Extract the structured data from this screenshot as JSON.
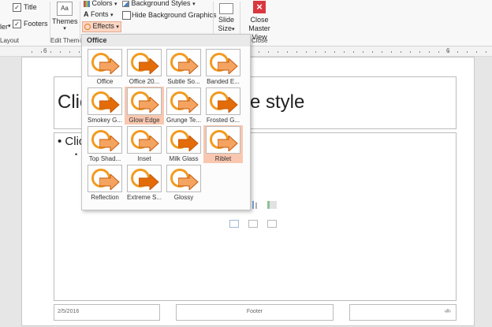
{
  "ribbon": {
    "layout_group": {
      "partial_label": "ler",
      "group_label": "Layout",
      "title_checkbox": {
        "label": "Title",
        "checked": true
      },
      "footers_checkbox": {
        "label": "Footers",
        "checked": true
      }
    },
    "edit_theme_group": {
      "themes_label": "Themes",
      "group_label": "Edit Theme"
    },
    "background_group": {
      "colors_label": "Colors",
      "fonts_label": "Fonts",
      "effects_label": "Effects",
      "background_styles_label": "Background Styles",
      "hide_background_label": "Hide Background Graphics"
    },
    "size_group": {
      "slide_size_label_1": "Slide",
      "slide_size_label_2": "Size"
    },
    "close_group": {
      "close_label_1": "Close",
      "close_label_2": "Master View",
      "group_label": "Close"
    }
  },
  "ruler": {
    "left_number": "6",
    "right_number": "6"
  },
  "slide": {
    "title_partial_left": "Clic",
    "title_partial_right": "e style",
    "body_partial": "Clic",
    "footer_date": "2/5/2016",
    "footer_text": "Footer",
    "footer_slide_number": "‹#›"
  },
  "effects_gallery": {
    "header": "Office",
    "tiles": [
      {
        "label": "Office",
        "selected": false
      },
      {
        "label": "Office 20...",
        "selected": false
      },
      {
        "label": "Subtle So...",
        "selected": false
      },
      {
        "label": "Banded E...",
        "selected": false
      },
      {
        "label": "Smokey G...",
        "selected": false
      },
      {
        "label": "Glow Edge",
        "selected": true
      },
      {
        "label": "Grunge Te...",
        "selected": false
      },
      {
        "label": "Frosted G...",
        "selected": false
      },
      {
        "label": "Top Shad...",
        "selected": false
      },
      {
        "label": "Inset",
        "selected": false
      },
      {
        "label": "Milk Glass",
        "selected": false
      },
      {
        "label": "Riblet",
        "selected": true
      },
      {
        "label": "Reflection",
        "selected": false
      },
      {
        "label": "Extreme S...",
        "selected": false
      },
      {
        "label": "Glossy",
        "selected": false
      }
    ]
  },
  "colors": {
    "accent_orange": "#f29a1f",
    "close_red": "#d9373f",
    "highlight": "#f9c7b0"
  }
}
